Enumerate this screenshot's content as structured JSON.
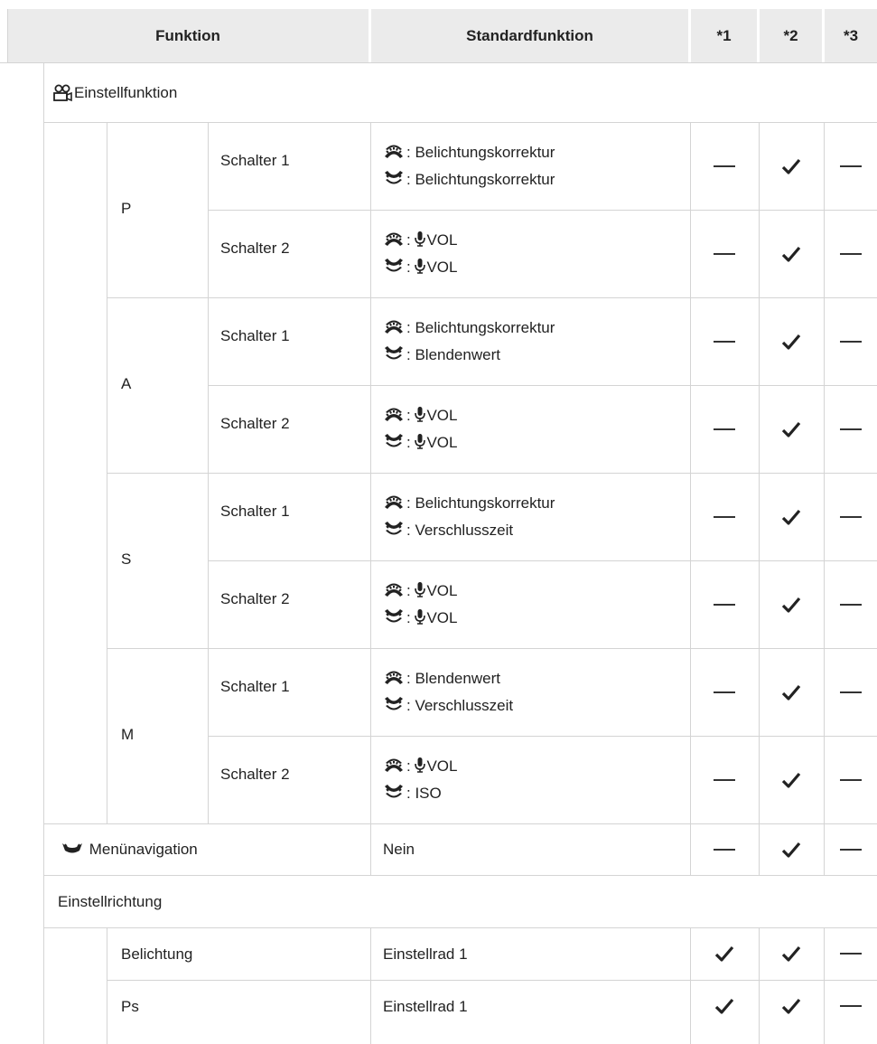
{
  "header": {
    "funktion": "Funktion",
    "standardfunktion": "Standardfunktion",
    "col1": "*1",
    "col2": "*2",
    "col3": "*3"
  },
  "einstellfunktion": {
    "label": "Einstellfunktion"
  },
  "modes": [
    {
      "mode": "P",
      "rows": [
        {
          "schalter": "Schalter 1",
          "front": "Belichtungskorrektur",
          "rear": "Belichtungskorrektur",
          "front_mic": false,
          "rear_mic": false,
          "c1": "dash",
          "c2": "check",
          "c3": "dash"
        },
        {
          "schalter": "Schalter 2",
          "front": "VOL",
          "rear": "VOL",
          "front_mic": true,
          "rear_mic": true,
          "c1": "dash",
          "c2": "check",
          "c3": "dash"
        }
      ]
    },
    {
      "mode": "A",
      "rows": [
        {
          "schalter": "Schalter 1",
          "front": "Belichtungskorrektur",
          "rear": "Blendenwert",
          "front_mic": false,
          "rear_mic": false,
          "c1": "dash",
          "c2": "check",
          "c3": "dash"
        },
        {
          "schalter": "Schalter 2",
          "front": "VOL",
          "rear": "VOL",
          "front_mic": true,
          "rear_mic": true,
          "c1": "dash",
          "c2": "check",
          "c3": "dash"
        }
      ]
    },
    {
      "mode": "S",
      "rows": [
        {
          "schalter": "Schalter 1",
          "front": "Belichtungskorrektur",
          "rear": "Verschlusszeit",
          "front_mic": false,
          "rear_mic": false,
          "c1": "dash",
          "c2": "check",
          "c3": "dash"
        },
        {
          "schalter": "Schalter 2",
          "front": "VOL",
          "rear": "VOL",
          "front_mic": true,
          "rear_mic": true,
          "c1": "dash",
          "c2": "check",
          "c3": "dash"
        }
      ]
    },
    {
      "mode": "M",
      "rows": [
        {
          "schalter": "Schalter 1",
          "front": "Blendenwert",
          "rear": "Verschlusszeit",
          "front_mic": false,
          "rear_mic": false,
          "c1": "dash",
          "c2": "check",
          "c3": "dash"
        },
        {
          "schalter": "Schalter 2",
          "front": "VOL",
          "rear": "ISO",
          "front_mic": true,
          "rear_mic": false,
          "c1": "dash",
          "c2": "check",
          "c3": "dash"
        }
      ]
    }
  ],
  "menu_navigation": {
    "label": "Menünavigation",
    "value": "Nein",
    "c1": "dash",
    "c2": "check",
    "c3": "dash"
  },
  "einstellrichtung": {
    "label": "Einstellrichtung",
    "rows": [
      {
        "label": "Belichtung",
        "value": "Einstellrad 1",
        "c1": "check",
        "c2": "check",
        "c3": "dash"
      },
      {
        "label": "Ps",
        "value": "Einstellrad 1",
        "c1": "check",
        "c2": "check",
        "c3": "dash"
      }
    ]
  },
  "icons": {
    "front_dial": "front-dial-icon",
    "rear_dial": "rear-dial-icon",
    "mic": "microphone-icon",
    "movie": "movie-camera-icon",
    "menu_nav": "dial-navigation-icon"
  },
  "colors": {
    "header_bg": "#ebebeb",
    "rule": "#d4d4d4",
    "text": "#222222"
  }
}
